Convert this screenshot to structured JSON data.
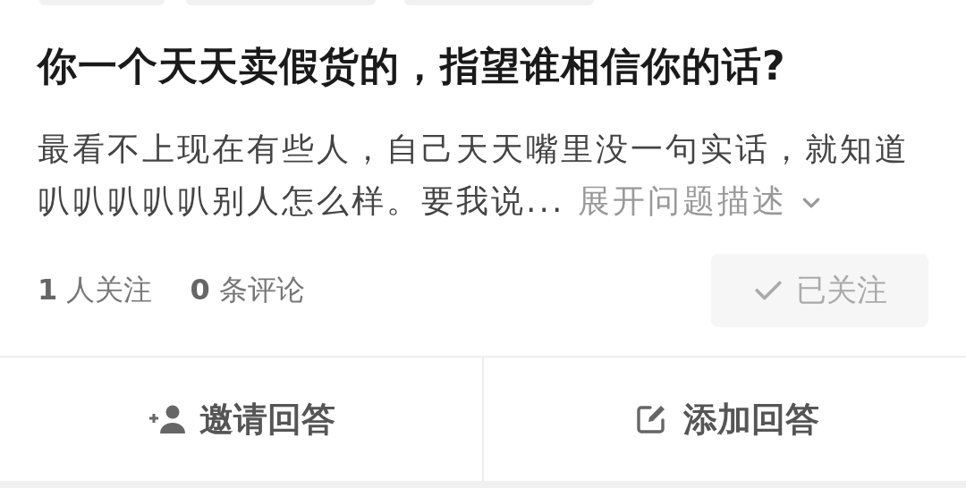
{
  "question": {
    "title": "你一个天天卖假货的，指望谁相信你的话?",
    "description": "最看不上现在有些人，自己天天嘴里没一句实话，就知道叭叭叭叭叭别人怎么样。要我说...",
    "expand_link": "展开问题描述",
    "stats": [
      "**1** 人关注",
      "**0** 条评论"
    ],
    "follow_button": {
      "label": "已关注",
      "followed": true
    }
  },
  "actions": [
    {
      "kind": "invite",
      "label": "邀请回答"
    },
    {
      "kind": "answer",
      "label": "添加回答"
    }
  ]
}
